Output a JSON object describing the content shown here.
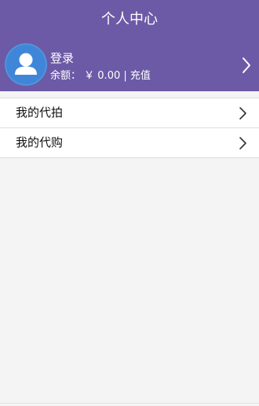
{
  "header": {
    "title": "个人中心",
    "background_color": "#6c5aa6"
  },
  "profile": {
    "avatar_icon": "user-avatar-icon",
    "avatar_color": "#3f86d8",
    "login_label": "登录",
    "balance_label": "余额：",
    "balance_value": "￥ 0.00",
    "separator": "|",
    "recharge_label": "充值",
    "chevron_icon": "chevron-right-icon"
  },
  "menu": {
    "items": [
      {
        "label": "我的代拍",
        "icon": "chevron-right-icon"
      },
      {
        "label": "我的代购",
        "icon": "chevron-right-icon"
      }
    ]
  }
}
